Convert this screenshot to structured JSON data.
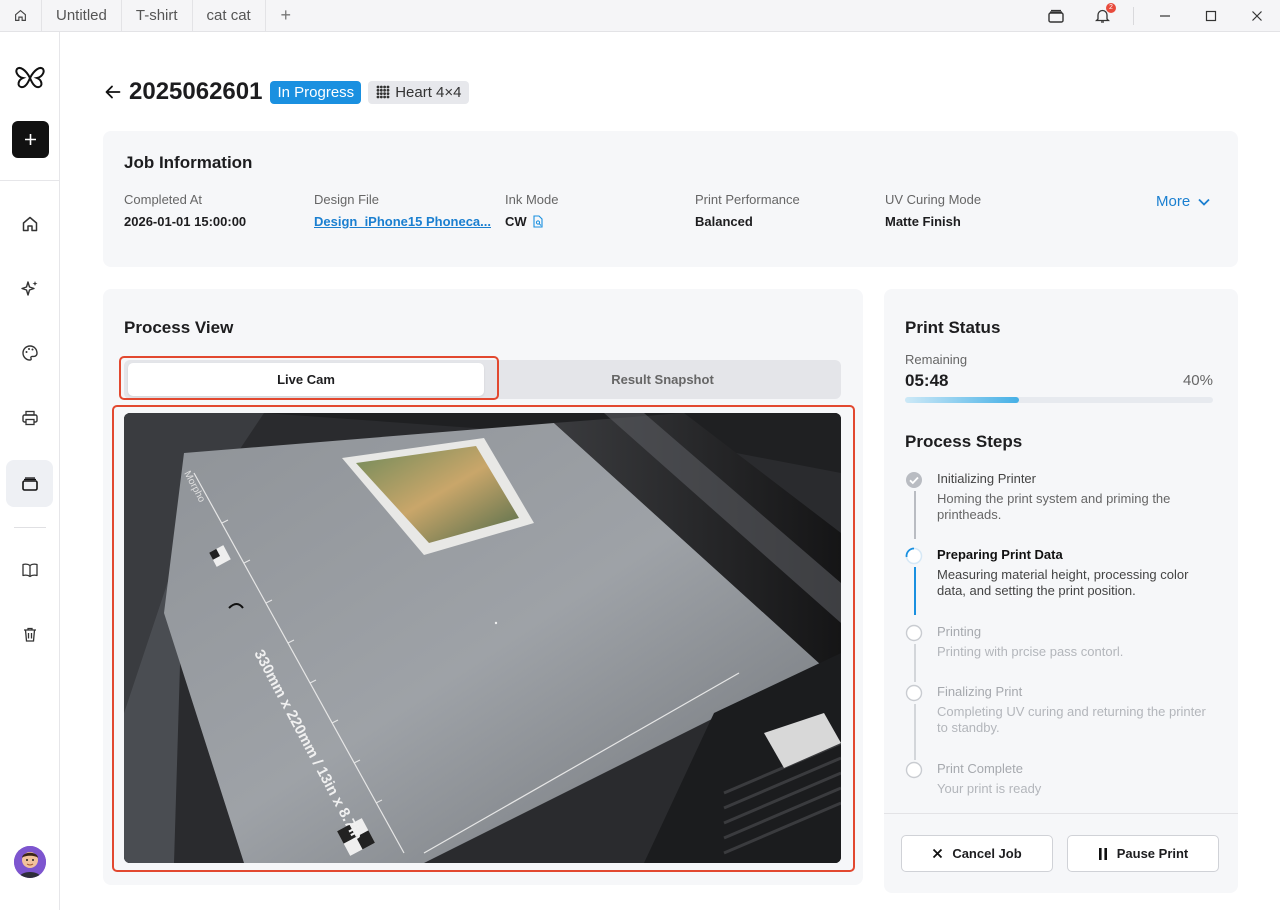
{
  "tabs": [
    {
      "label": "Untitled"
    },
    {
      "label": "T-shirt"
    },
    {
      "label": "cat cat"
    }
  ],
  "notifications": {
    "count": "2"
  },
  "header": {
    "job_id": "2025062601",
    "status": "In Progress",
    "pattern": "Heart 4×4"
  },
  "job_info": {
    "title": "Job Information",
    "fields": [
      {
        "label": "Completed At",
        "value": "2026-01-01 15:00:00"
      },
      {
        "label": "Design File",
        "value": "Design_iPhone15 Phoneca..."
      },
      {
        "label": "Ink Mode",
        "value": "CW"
      },
      {
        "label": "Print Performance",
        "value": "Balanced"
      },
      {
        "label": "UV Curing Mode",
        "value": "Matte Finish"
      }
    ],
    "more_label": "More"
  },
  "process_view": {
    "title": "Process View",
    "tabs": [
      {
        "label": "Live Cam",
        "active": true
      },
      {
        "label": "Result Snapshot",
        "active": false
      }
    ]
  },
  "print_status": {
    "title": "Print Status",
    "remaining_label": "Remaining",
    "remaining_value": "05:48",
    "percent_label": "40%",
    "progress_fraction": 0.37,
    "steps_title": "Process Steps",
    "steps": [
      {
        "title": "Initializing Printer",
        "desc": "Homing the print system and priming the printheads.",
        "state": "done"
      },
      {
        "title": "Preparing Print Data",
        "desc": "Measuring material height, processing color data, and setting the print position.",
        "state": "active"
      },
      {
        "title": "Printing",
        "desc": "Printing with prcise pass contorl.",
        "state": "pending"
      },
      {
        "title": "Finalizing Print",
        "desc": "Completing UV curing and returning the printer to standby.",
        "state": "pending"
      },
      {
        "title": "Print Complete",
        "desc": "Your print is ready",
        "state": "pending"
      }
    ],
    "cancel_label": "Cancel Job",
    "pause_label": "Pause Print"
  },
  "camera": {
    "bed_label": "330mm x 220mm / 13in x 8.7in",
    "brand": "Morpho"
  },
  "colors": {
    "accent": "#1a90e0",
    "highlight": "#e2482f",
    "link": "#1a7fd0"
  }
}
